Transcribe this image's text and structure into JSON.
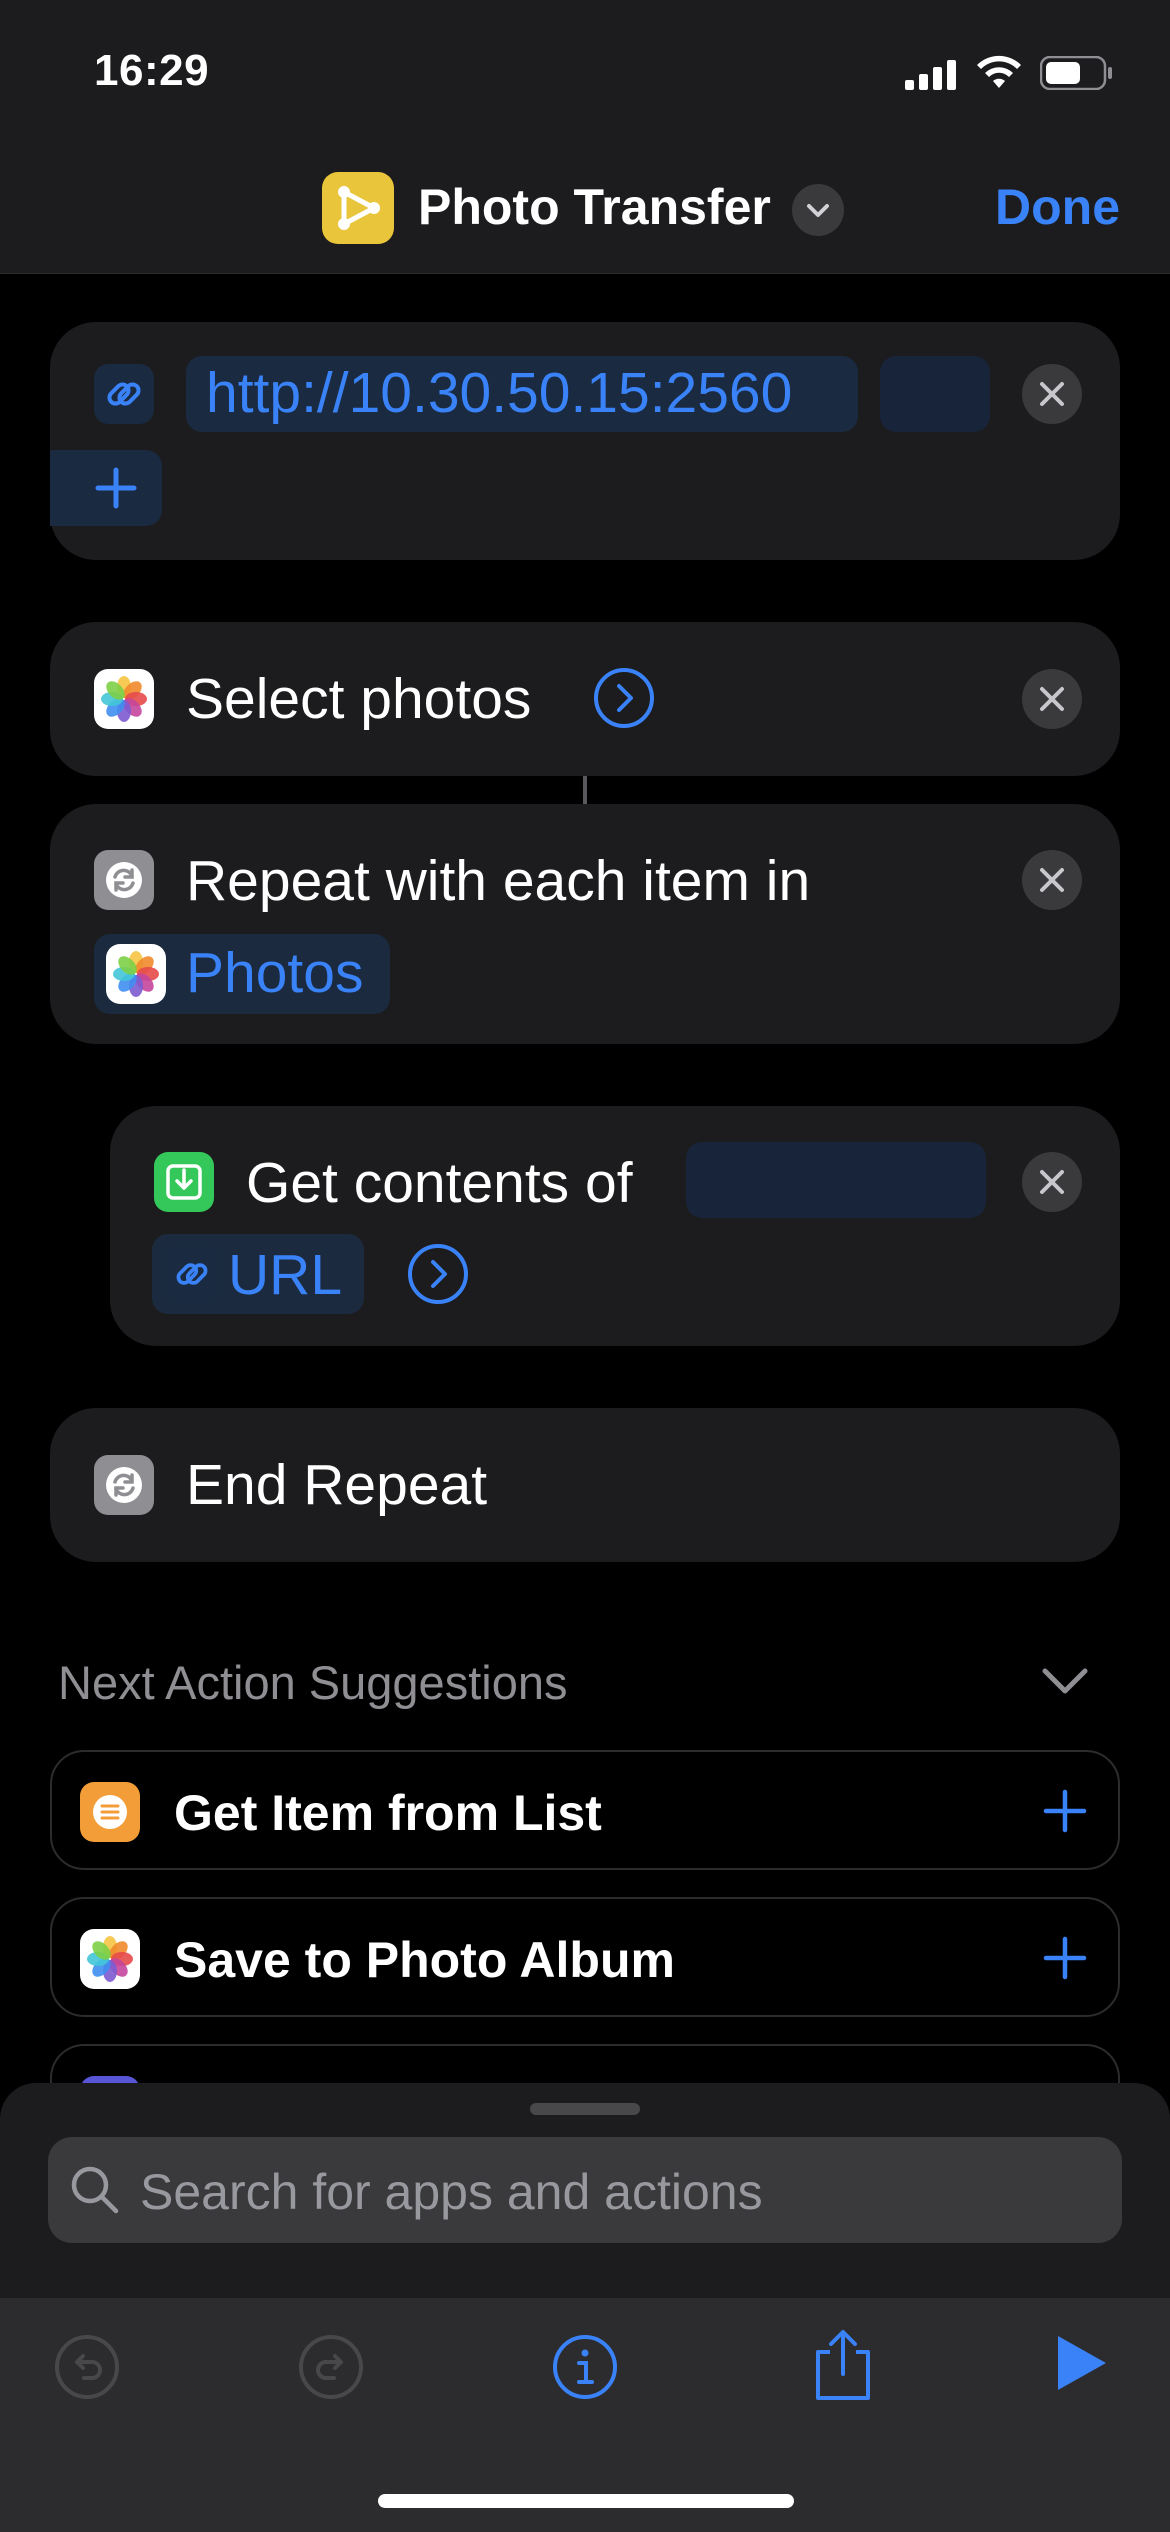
{
  "status_bar": {
    "time": "16:29"
  },
  "header": {
    "title": "Photo Transfer",
    "done_label": "Done"
  },
  "actions": {
    "url": {
      "value": "http://10.30.50.15:2560"
    },
    "select_photos": {
      "label": "Select photos"
    },
    "repeat": {
      "label": "Repeat with each item in",
      "variable": "Photos"
    },
    "get_contents": {
      "label": "Get contents of",
      "variable": "URL"
    },
    "end_repeat": {
      "label": "End Repeat"
    }
  },
  "suggestions": {
    "header": "Next Action Suggestions",
    "items": [
      {
        "label": "Get Item from List",
        "icon": "list-icon",
        "color": "#f29d38"
      },
      {
        "label": "Save to Photo Album",
        "icon": "photos-icon",
        "color": "#ffffff"
      }
    ]
  },
  "search": {
    "placeholder": "Search for apps and actions"
  },
  "colors": {
    "accent": "#3a82f7",
    "background": "#000000",
    "card": "#1c1c1e",
    "app_icon": "#e8c53a"
  }
}
